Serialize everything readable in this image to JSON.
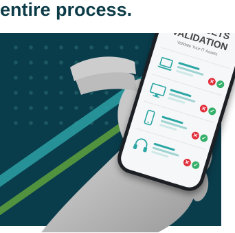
{
  "caption": {
    "text": "entire process."
  },
  "phone_app": {
    "title_line1": "MY ASSETS",
    "title_line2": "VALIDATION",
    "subtitle": "Validate Your IT Assets",
    "reject_symbol": "✕",
    "accept_symbol": "✓",
    "devices": [
      {
        "icon": "laptop-icon"
      },
      {
        "icon": "monitor-icon"
      },
      {
        "icon": "smartphone-icon"
      },
      {
        "icon": "headphones-icon"
      }
    ]
  },
  "colors": {
    "panel": "#0a3d4c",
    "accent_teal": "#2aa6a4",
    "accent_green": "#6fb73b",
    "reject": "#e0303c",
    "accept": "#35b06a"
  }
}
